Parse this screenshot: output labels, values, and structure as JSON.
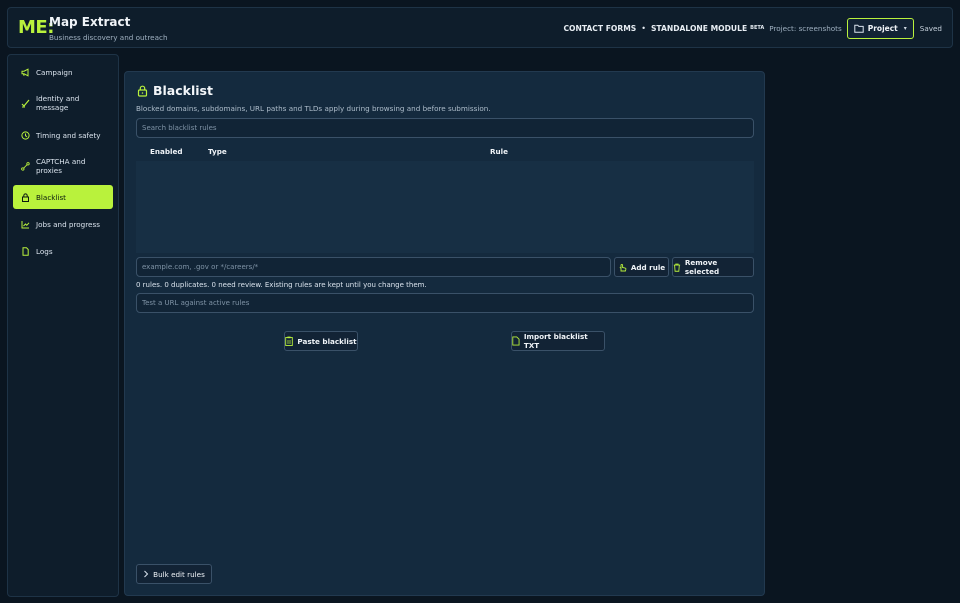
{
  "header": {
    "logo": "ME:",
    "title": "Map Extract",
    "subtitle": "Business discovery and outreach",
    "module_1": "CONTACT FORMS",
    "separator": "•",
    "module_2": "STANDALONE MODULE",
    "beta": "BETA",
    "project_label": "Project: screenshots",
    "project_button": "Project",
    "save_status": "Saved"
  },
  "sidebar": {
    "items": [
      {
        "label": "Campaign",
        "icon": "megaphone-icon"
      },
      {
        "label": "Identity and message",
        "icon": "pen-icon"
      },
      {
        "label": "Timing and safety",
        "icon": "clock-icon"
      },
      {
        "label": "CAPTCHA and proxies",
        "icon": "network-icon"
      },
      {
        "label": "Blacklist",
        "icon": "lock-icon",
        "active": true
      },
      {
        "label": "Jobs and progress",
        "icon": "chart-icon"
      },
      {
        "label": "Logs",
        "icon": "file-icon"
      }
    ]
  },
  "main": {
    "title": "Blacklist",
    "description": "Blocked domains, subdomains, URL paths and TLDs apply during browsing and before submission.",
    "search_placeholder": "Search blacklist rules",
    "columns": [
      "Enabled",
      "Type",
      "Rule"
    ],
    "rows": [],
    "rule_placeholder": "example.com, .gov or */careers/*",
    "add_rule": "Add rule",
    "remove_selected": "Remove selected",
    "status": "0 rules. 0 duplicates. 0 need review. Existing rules are kept until you change them.",
    "test_placeholder": "Test a URL against active rules",
    "paste_blacklist": "Paste blacklist",
    "import_blacklist": "Import blacklist TXT",
    "bulk_edit": "Bulk edit rules"
  },
  "colors": {
    "accent": "#b9f23c",
    "background": "#0a1520",
    "panel": "#142a3e"
  }
}
